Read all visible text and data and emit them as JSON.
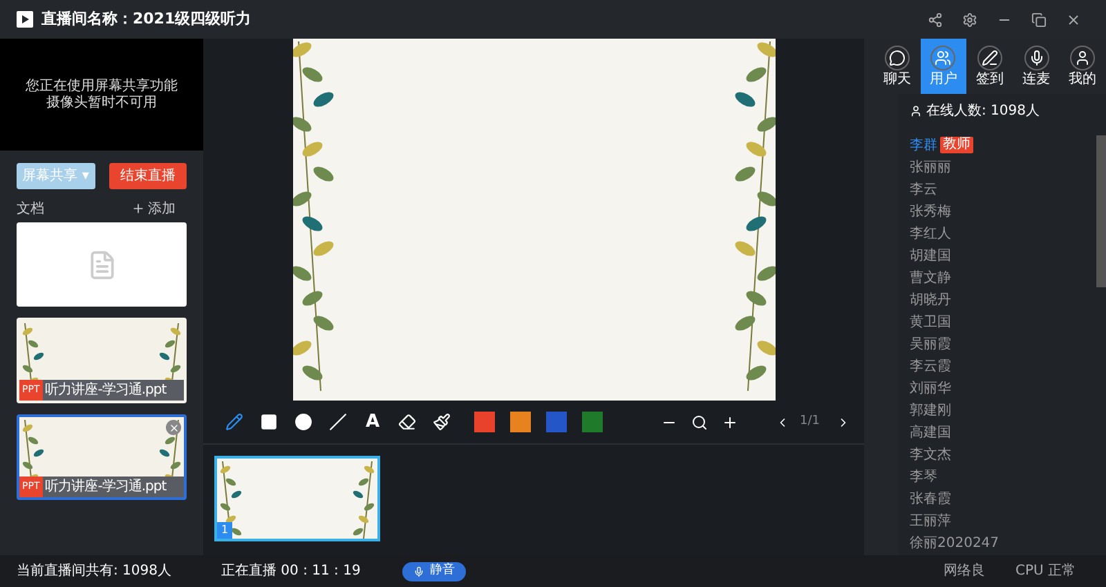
{
  "window": {
    "title": "直播间名称：2021级四级听力"
  },
  "video": {
    "lines": [
      "您正在使用屏幕共享功能",
      "摄像头暂时不可用"
    ]
  },
  "actions": {
    "share": "屏幕共享 ▾",
    "end": "结束直播"
  },
  "documents": {
    "title": "文档",
    "add": "添加",
    "files": [
      {
        "badge": "PPT",
        "name": "听力讲座-学习通.ppt",
        "selected": false
      },
      {
        "badge": "PPT",
        "name": "听力讲座-学习通.ppt",
        "selected": true
      }
    ]
  },
  "toolbar": {
    "tools": [
      {
        "kind": "pen",
        "selected": true
      },
      {
        "kind": "square",
        "selected": false
      },
      {
        "kind": "circle",
        "selected": false
      },
      {
        "kind": "line",
        "selected": false
      },
      {
        "kind": "text",
        "label": "A",
        "selected": false
      },
      {
        "kind": "eraser",
        "selected": false
      },
      {
        "kind": "clear",
        "selected": false
      }
    ],
    "colors": [
      {
        "color": "#e8412c"
      },
      {
        "color": "#e8821e"
      },
      {
        "color": "#2456c8"
      },
      {
        "color": "#1f7a2a"
      }
    ],
    "page": "1/1"
  },
  "thumbnails": [
    {
      "number": "1",
      "selected": true
    }
  ],
  "tabs": [
    {
      "kind": "chat",
      "label": "聊天",
      "selected": false
    },
    {
      "kind": "users",
      "label": "用户",
      "selected": true
    },
    {
      "kind": "sign",
      "label": "签到",
      "selected": false
    },
    {
      "kind": "mic",
      "label": "连麦",
      "selected": false
    },
    {
      "kind": "me",
      "label": "我的",
      "selected": false
    }
  ],
  "users": {
    "online": "在线人数: 1098人",
    "list": [
      {
        "name": "李群",
        "badge": "教师"
      },
      {
        "name": "张丽丽"
      },
      {
        "name": "李云"
      },
      {
        "name": "张秀梅"
      },
      {
        "name": "李红人"
      },
      {
        "name": "胡建国"
      },
      {
        "name": "曹文静"
      },
      {
        "name": "胡晓丹"
      },
      {
        "name": "黄卫国"
      },
      {
        "name": "吴丽霞"
      },
      {
        "name": "李云霞"
      },
      {
        "name": "刘丽华"
      },
      {
        "name": "郭建刚"
      },
      {
        "name": "高建国"
      },
      {
        "name": "李文杰"
      },
      {
        "name": "李琴"
      },
      {
        "name": "张春霞"
      },
      {
        "name": "王丽萍"
      },
      {
        "name": "徐丽2020247"
      }
    ]
  },
  "status_bar": {
    "total": "当前直播间共有: 1098人",
    "live": "正在直播 00 : 11 : 19",
    "mute": "静音",
    "network": "网络良",
    "cpu": "CPU 正常"
  }
}
